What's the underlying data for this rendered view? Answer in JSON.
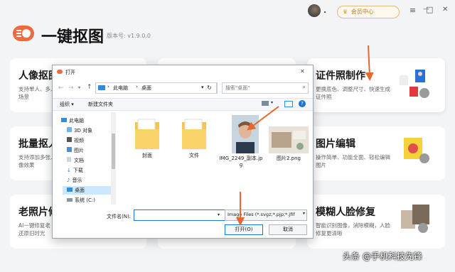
{
  "app": {
    "title": "一键抠图",
    "version": "版本号: v1.9.0.0",
    "vip_label": "会员中心"
  },
  "window_controls": {
    "menu": "≡",
    "minimize": "—",
    "maximize": "□",
    "close": "✕"
  },
  "cards": [
    {
      "title": "人像抠图",
      "desc": "支持单人、多人\n场景"
    },
    {
      "title": "证件照制作",
      "desc": "更换底色、调整尺寸、快速生成\n证件照"
    },
    {
      "title": "批量抠人",
      "desc": "支持添加多张人\n像效果"
    },
    {
      "title": "图片编辑",
      "desc": "操作简单、功能全面、轻松编辑\n图片"
    },
    {
      "title": "老照片修",
      "desc": "AI一键修复老\n还原旧时光"
    },
    {
      "title": "模糊人脸修复",
      "desc": "智能识别图像，消除模糊，人脸\n修复更清晰"
    }
  ],
  "dialog": {
    "title": "打开",
    "close": "✕",
    "breadcrumb": [
      "此电脑",
      "桌面"
    ],
    "search_placeholder": "搜索\"桌面\"",
    "organize": "组织 ▾",
    "new_folder": "新建文件夹",
    "help": "?",
    "tree": [
      "此电脑",
      "3D 对象",
      "视频",
      "图片",
      "文档",
      "下载",
      "音乐",
      "桌面",
      "系统 (C:)"
    ],
    "files": [
      {
        "name": "封面",
        "type": "folder"
      },
      {
        "name": "文件",
        "type": "folder"
      },
      {
        "name": "IMG_2249_副本.jpg",
        "type": "photo"
      },
      {
        "name": "图片2.png",
        "type": "image"
      }
    ],
    "filename_label": "文件名(N):",
    "filename_value": "",
    "filetype": "Image Files (*.svgz;*.pjp;*.jfif",
    "open_button": "打开(O)",
    "cancel_button": "取消"
  },
  "watermark": "头条 @手机科技先锋",
  "colors": {
    "accent": "#f06a3f",
    "vip": "#c98a2a",
    "dialog_selection": "#cce8ff",
    "blue": "#1976d2"
  }
}
